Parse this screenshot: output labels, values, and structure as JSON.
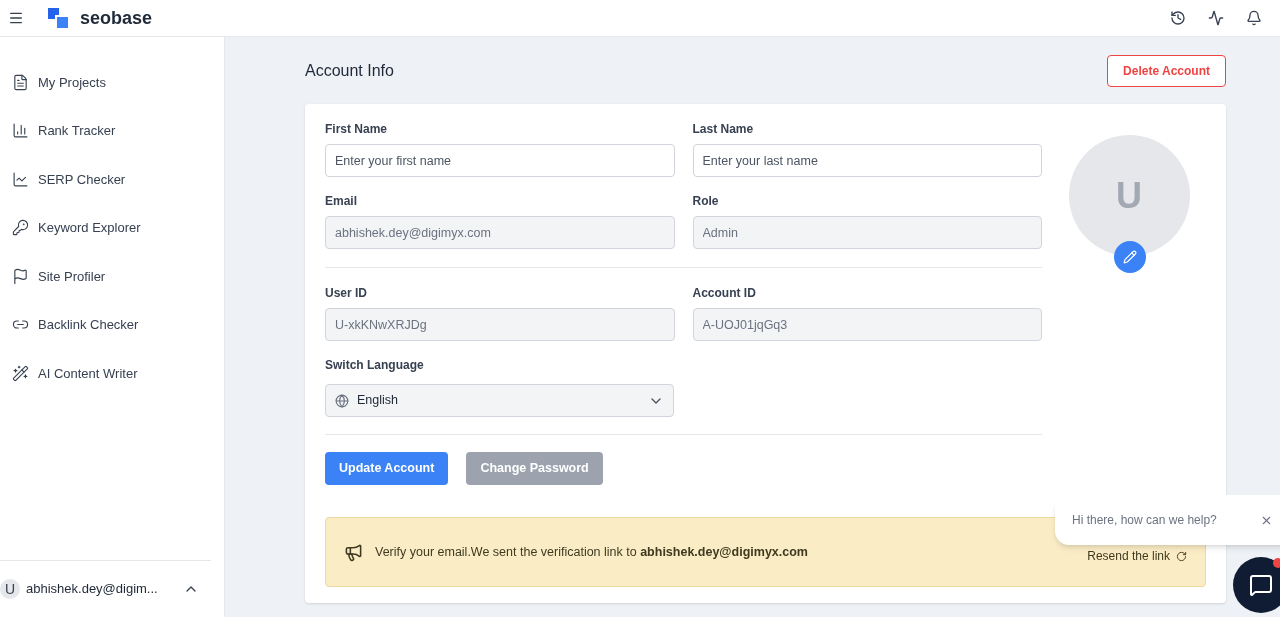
{
  "header": {
    "brand": "seobase"
  },
  "sidebar": {
    "items": [
      {
        "label": "My Projects"
      },
      {
        "label": "Rank Tracker"
      },
      {
        "label": "SERP Checker"
      },
      {
        "label": "Keyword Explorer"
      },
      {
        "label": "Site Profiler"
      },
      {
        "label": "Backlink Checker"
      },
      {
        "label": "AI Content Writer"
      }
    ],
    "user": {
      "initial": "U",
      "email": "abhishek.dey@digim..."
    }
  },
  "page": {
    "title": "Account Info",
    "delete_button": "Delete Account"
  },
  "form": {
    "rows": [
      [
        {
          "label": "First Name",
          "placeholder": "Enter your first name",
          "disabled": false
        },
        {
          "label": "Last Name",
          "placeholder": "Enter your last name",
          "disabled": false
        }
      ],
      [
        {
          "label": "Email",
          "value": "abhishek.dey@digimyx.com",
          "disabled": true
        },
        {
          "label": "Role",
          "value": "Admin",
          "disabled": true
        }
      ],
      [
        {
          "label": "User ID",
          "value": "U-xkKNwXRJDg",
          "disabled": true
        },
        {
          "label": "Account ID",
          "value": "A-UOJ01jqGq3",
          "disabled": true
        }
      ]
    ],
    "language": {
      "label": "Switch Language",
      "value": "English"
    },
    "buttons": [
      {
        "label": "Update Account",
        "disabled": false
      },
      {
        "label": "Change Password",
        "disabled": true
      }
    ]
  },
  "avatar": {
    "initial": "U"
  },
  "banner": {
    "text": "Verify your email.We sent the verification link to **abhishek.dey@digimyx.com**",
    "action": "Resend the link"
  },
  "chat": {
    "message": "Hi there, how can we help?",
    "unread": true
  }
}
